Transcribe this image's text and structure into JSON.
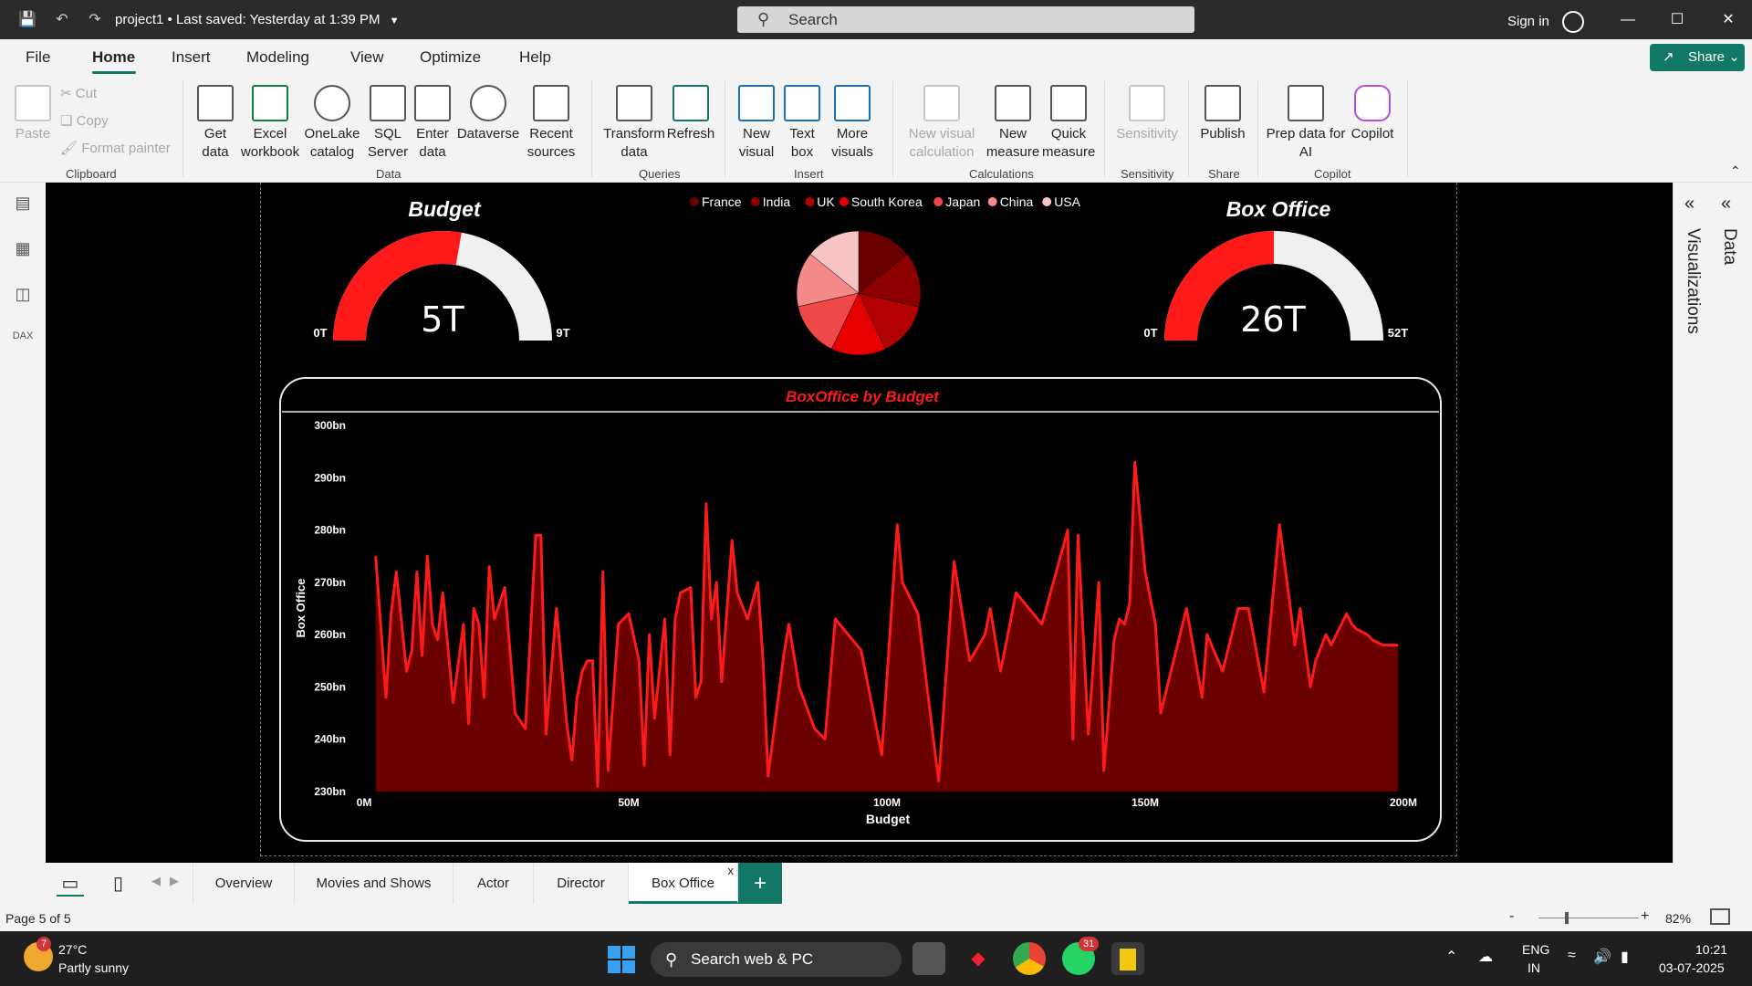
{
  "titlebar": {
    "document_title": "project1",
    "saved_status": "Last saved: Yesterday at 1:39 PM",
    "search_placeholder": "Search",
    "sign_in": "Sign in"
  },
  "menu": {
    "items": [
      "File",
      "Home",
      "Insert",
      "Modeling",
      "View",
      "Optimize",
      "Help"
    ],
    "active": "Home",
    "share_label": "Share"
  },
  "ribbon": {
    "clipboard": {
      "paste": "Paste",
      "cut": "Cut",
      "copy": "Copy",
      "format_painter": "Format painter",
      "group": "Clipboard"
    },
    "data": {
      "get_data": "Get data",
      "excel": "Excel workbook",
      "onelake": "OneLake catalog",
      "sql": "SQL Server",
      "enter": "Enter data",
      "dataverse": "Dataverse",
      "recent": "Recent sources",
      "group": "Data"
    },
    "queries": {
      "transform": "Transform data",
      "refresh": "Refresh",
      "group": "Queries"
    },
    "insert": {
      "new_visual": "New visual",
      "text_box": "Text box",
      "more_visuals": "More visuals",
      "group": "Insert"
    },
    "calculations": {
      "new_visual_calc": "New visual calculation",
      "new_measure": "New measure",
      "quick_measure": "Quick measure",
      "group": "Calculations"
    },
    "sensitivity": {
      "label": "Sensitivity",
      "group": "Sensitivity"
    },
    "share": {
      "publish": "Publish",
      "group": "Share"
    },
    "copilot": {
      "prep": "Prep data for AI",
      "copilot": "Copilot",
      "group": "Copilot"
    }
  },
  "report": {
    "budget_gauge": {
      "title": "Budget",
      "value_label": "5T",
      "min_label": "0T",
      "max_label": "9T",
      "value": 5,
      "max": 9,
      "fill_color": "#ff1a1a",
      "track_color": "#f0f0f0"
    },
    "boxoffice_gauge": {
      "title": "Box Office",
      "value_label": "26T",
      "min_label": "0T",
      "max_label": "52T",
      "value": 26,
      "max": 52,
      "fill_color": "#ff1a1a",
      "track_color": "#f0f0f0"
    },
    "pie_legend": [
      {
        "name": "France",
        "color": "#6b0000"
      },
      {
        "name": "India",
        "color": "#8e0000"
      },
      {
        "name": "UK",
        "color": "#b30000"
      },
      {
        "name": "South Korea",
        "color": "#e60000"
      },
      {
        "name": "Japan",
        "color": "#f04848"
      },
      {
        "name": "China",
        "color": "#f48a8a"
      },
      {
        "name": "USA",
        "color": "#f6c4c4"
      }
    ],
    "pie_values": [
      14.3,
      14.3,
      14.3,
      14.3,
      14.3,
      14.3,
      14.2
    ]
  },
  "chart_data": {
    "type": "area",
    "title": "BoxOffice by Budget",
    "xlabel": "Budget",
    "ylabel": "Box Office",
    "x_ticks": [
      "0M",
      "50M",
      "100M",
      "150M",
      "200M"
    ],
    "y_ticks": [
      "230bn",
      "240bn",
      "250bn",
      "260bn",
      "270bn",
      "280bn",
      "290bn",
      "300bn"
    ],
    "xlim": [
      0,
      200
    ],
    "ylim": [
      230,
      300
    ],
    "line_color": "#ff1a1a",
    "fill_color": "#6b0000",
    "x": [
      1,
      3,
      4,
      5,
      7,
      8,
      9,
      10,
      11,
      12,
      13,
      14,
      16,
      18,
      19,
      20,
      21,
      22,
      23,
      24,
      26,
      28,
      30,
      32,
      33,
      34,
      36,
      38,
      39,
      40,
      41,
      42,
      43,
      44,
      45,
      46,
      48,
      50,
      52,
      53,
      54,
      55,
      57,
      58,
      59,
      60,
      62,
      63,
      64,
      65,
      66,
      67,
      68,
      70,
      71,
      73,
      75,
      76,
      77,
      80,
      81,
      83,
      86,
      88,
      90,
      95,
      99,
      102,
      103,
      106,
      110,
      113,
      116,
      119,
      120,
      122,
      125,
      130,
      135,
      136,
      137,
      139,
      140,
      141,
      142,
      144,
      145,
      146,
      147,
      148,
      150,
      152,
      153,
      155,
      158,
      161,
      162,
      165,
      168,
      170,
      173,
      176,
      178,
      179,
      180,
      182,
      183,
      185,
      186,
      188,
      189,
      190,
      191,
      193,
      194,
      196,
      199
    ],
    "y": [
      275,
      248,
      264,
      272,
      253,
      257,
      272,
      256,
      275,
      262,
      259,
      268,
      247,
      262,
      243,
      265,
      262,
      248,
      273,
      263,
      269,
      245,
      242,
      279,
      279,
      241,
      265,
      243,
      236,
      248,
      253,
      255,
      255,
      231,
      272,
      234,
      262,
      264,
      255,
      235,
      260,
      244,
      263,
      237,
      263,
      268,
      269,
      248,
      251,
      285,
      263,
      270,
      251,
      278,
      268,
      263,
      270,
      255,
      233,
      256,
      262,
      250,
      242,
      240,
      263,
      257,
      237,
      281,
      270,
      264,
      232,
      274,
      255,
      260,
      265,
      253,
      268,
      262,
      280,
      240,
      279,
      241,
      255,
      270,
      234,
      259,
      263,
      262,
      266,
      293,
      272,
      262,
      245,
      253,
      265,
      248,
      260,
      253,
      265,
      265,
      249,
      281,
      266,
      258,
      265,
      250,
      255,
      260,
      258,
      262,
      264,
      262,
      261,
      260,
      259,
      258,
      258
    ],
    "grid": false
  },
  "tabs": {
    "items": [
      "Overview",
      "Movies and Shows",
      "Actor",
      "Director",
      "Box Office"
    ],
    "active": "Box Office"
  },
  "status": {
    "page": "Page 5 of 5",
    "zoom": "82%"
  },
  "taskbar": {
    "weather_temp": "27°C",
    "weather_desc": "Partly sunny",
    "weather_badge": "7",
    "search": "Search web & PC",
    "whatsapp_badge": "31",
    "lang": "ENG",
    "region": "IN",
    "time": "10:21",
    "date": "03-07-2025"
  },
  "side_panels": {
    "visualizations": "Visualizations",
    "data": "Data"
  }
}
